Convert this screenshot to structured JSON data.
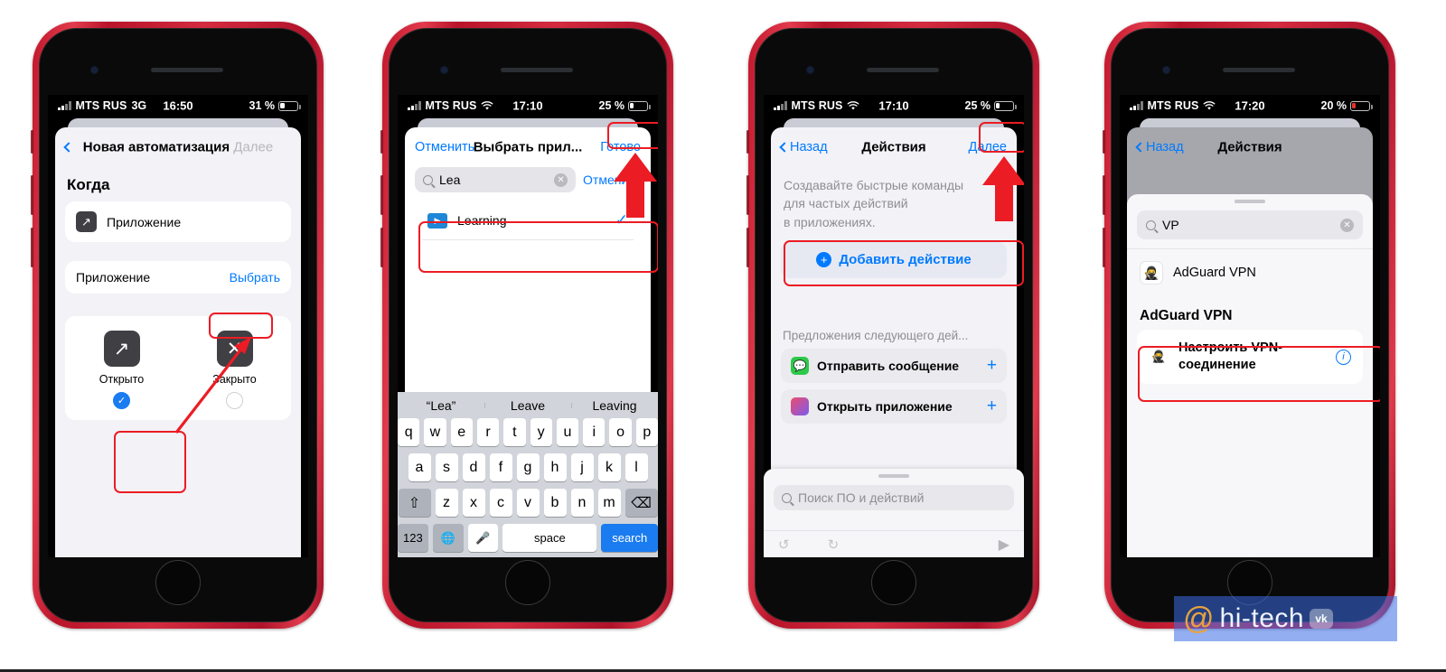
{
  "phones": [
    {
      "status": {
        "carrier": "MTS RUS",
        "network": "3G",
        "wifi": false,
        "time": "16:50",
        "battery_pct": "31 %",
        "battery_level": 31
      },
      "nav": {
        "back_icon": "chevron-left-icon",
        "title": "Новая автоматизация",
        "right_label": "Далее",
        "right_dim": true
      },
      "section_header": "Когда",
      "trigger_row": {
        "icon": "arrow-up-right-icon",
        "label": "Приложение"
      },
      "app_row": {
        "label": "Приложение",
        "action": "Выбрать"
      },
      "tiles": [
        {
          "icon": "arrow-up-right-icon",
          "label": "Открыто",
          "selected": true
        },
        {
          "icon": "close-x-icon",
          "label": "Закрыто",
          "selected": false
        }
      ]
    },
    {
      "status": {
        "carrier": "MTS RUS",
        "network": "",
        "wifi": true,
        "time": "17:10",
        "battery_pct": "25 %",
        "battery_level": 25
      },
      "nav": {
        "left_label": "Отменить",
        "title": "Выбрать прил...",
        "right_label": "Готово"
      },
      "search": {
        "icon": "search-icon",
        "value": "Lea",
        "clear_icon": "clear-circle-icon",
        "cancel_label": "Отменить"
      },
      "results": [
        {
          "icon": "learning-app-icon",
          "label": "Learning",
          "checked": true
        }
      ],
      "keyboard": {
        "suggestions": [
          "“Lea”",
          "Leave",
          "Leaving"
        ],
        "row1": [
          "q",
          "w",
          "e",
          "r",
          "t",
          "y",
          "u",
          "i",
          "o",
          "p"
        ],
        "row2": [
          "a",
          "s",
          "d",
          "f",
          "g",
          "h",
          "j",
          "k",
          "l"
        ],
        "row3": [
          "z",
          "x",
          "c",
          "v",
          "b",
          "n",
          "m"
        ],
        "shift_icon": "shift-icon",
        "backspace_icon": "backspace-icon",
        "numbers_label": "123",
        "globe_icon": "globe-icon",
        "mic_icon": "microphone-icon",
        "space_label": "space",
        "return_label": "search"
      }
    },
    {
      "status": {
        "carrier": "MTS RUS",
        "network": "",
        "wifi": true,
        "time": "17:10",
        "battery_pct": "25 %",
        "battery_level": 25
      },
      "nav": {
        "back_label": "Назад",
        "title": "Действия",
        "right_label": "Далее"
      },
      "description": [
        "Создавайте быстрые команды",
        "для частых действий",
        "в приложениях."
      ],
      "add_action": {
        "icon": "plus-circle-icon",
        "label": "Добавить действие"
      },
      "suggestions_title": "Предложения следующего дей...",
      "suggestions": [
        {
          "icon": "messages-app-icon",
          "label": "Отправить сообщение",
          "add_icon": "plus-icon"
        },
        {
          "icon": "appgrid-icon",
          "label": "Открыть приложение",
          "add_icon": "plus-icon"
        }
      ],
      "bottom_search": {
        "icon": "search-icon",
        "placeholder": "Поиск ПО и действий"
      },
      "toolbar": {
        "undo_icon": "undo-icon",
        "redo_icon": "redo-icon",
        "play_icon": "play-icon"
      }
    },
    {
      "status": {
        "carrier": "MTS RUS",
        "network": "",
        "wifi": true,
        "time": "17:20",
        "battery_pct": "20 %",
        "battery_level": 20
      },
      "nav": {
        "back_label": "Назад",
        "title": "Действия"
      },
      "search": {
        "icon": "search-icon",
        "value": "VP",
        "clear_icon": "clear-circle-icon"
      },
      "app_result": {
        "icon": "adguard-icon",
        "label": "AdGuard VPN"
      },
      "group_header": "AdGuard VPN",
      "action_row": {
        "icon": "adguard-icon",
        "label": "Настроить VPN-соединение",
        "info_icon": "info-circle-icon"
      }
    }
  ],
  "watermark": {
    "at": "@",
    "text": "hi-tech",
    "badge": "vk"
  },
  "colors": {
    "accent_blue": "#007aff",
    "annotation_red": "#ec1c24",
    "frame_red": "#d42b40"
  }
}
